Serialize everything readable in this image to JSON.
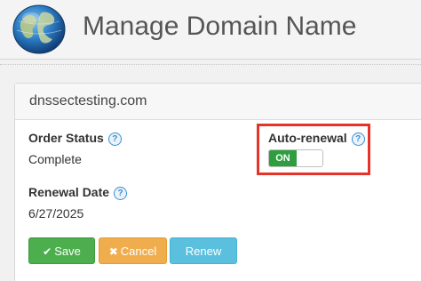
{
  "header": {
    "title": "Manage Domain Name",
    "logo_icon": "globe-icon"
  },
  "domain": {
    "name": "dnssectesting.com"
  },
  "order_status": {
    "label": "Order Status",
    "value": "Complete",
    "help_icon": "question-icon",
    "help_glyph": "?"
  },
  "auto_renewal": {
    "label": "Auto-renewal",
    "help_icon": "question-icon",
    "help_glyph": "?",
    "toggle_label": "ON",
    "state": "on",
    "highlight_color": "#e5332a"
  },
  "renewal_date": {
    "label": "Renewal Date",
    "value": "6/27/2025",
    "help_icon": "question-icon",
    "help_glyph": "?"
  },
  "actions": {
    "save_label": "Save",
    "save_icon": "check-icon",
    "save_glyph": "✔",
    "cancel_label": "Cancel",
    "cancel_icon": "close-icon",
    "cancel_glyph": "✖",
    "renew_label": "Renew"
  },
  "colors": {
    "save": "#4cae4c",
    "cancel": "#f0ad4e",
    "renew": "#5bc0de",
    "toggle_on": "#2f9e3f",
    "help": "#3a8fd0"
  }
}
